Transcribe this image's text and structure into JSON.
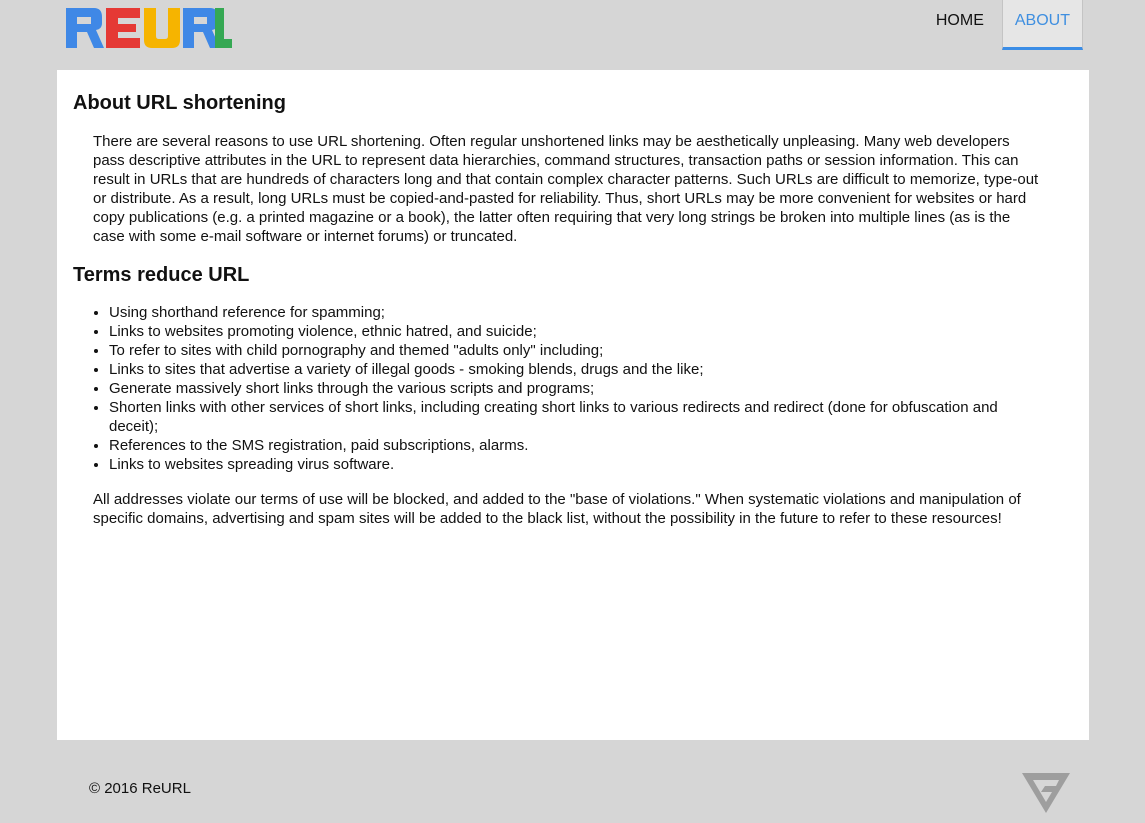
{
  "header": {
    "logo_text": "ReURL",
    "nav": [
      {
        "label": "HOME",
        "active": false
      },
      {
        "label": "ABOUT",
        "active": true
      }
    ]
  },
  "colors": {
    "page_bg": "#d6d6d6",
    "card_bg": "#ffffff",
    "accent": "#3b8de6",
    "logo_blue": "#3f88e6",
    "logo_red": "#e53935",
    "logo_yellow": "#f6b400",
    "logo_green": "#35a853",
    "footer_logo": "#9e9e9e"
  },
  "main": {
    "title": "About URL shortening",
    "intro": "There are several reasons to use URL shortening. Often regular unshortened links may be aesthetically unpleasing. Many web developers pass descriptive attributes in the URL to represent data hierarchies, command structures, transaction paths or session information. This can result in URLs that are hundreds of characters long and that contain complex character patterns. Such URLs are difficult to memorize, type-out or distribute. As a result, long URLs must be copied-and-pasted for reliability. Thus, short URLs may be more convenient for websites or hard copy publications (e.g. a printed magazine or a book), the latter often requiring that very long strings be broken into multiple lines (as is the case with some e-mail software or internet forums) or truncated.",
    "terms_title": "Terms reduce URL",
    "terms": [
      "Using shorthand reference for spamming;",
      "Links to websites promoting violence, ethnic hatred, and suicide;",
      "To refer to sites with child pornography and themed \"adults only\" including;",
      "Links to sites that advertise a variety of illegal goods - smoking blends, drugs and the like;",
      "Generate massively short links through the various scripts and programs;",
      "Shorten links with other services of short links, including creating short links to various redirects and redirect (done for obfuscation and deceit);",
      "References to the SMS registration, paid subscriptions, alarms.",
      "Links to websites spreading virus software."
    ],
    "closing": "All addresses violate our terms of use will be blocked, and added to the \"base of violations.\" When systematic violations and manipulation of specific domains, advertising and spam sites will be added to the black list, without the possibility in the future to refer to these resources!"
  },
  "footer": {
    "copyright": "© 2016 ReURL",
    "logo_icon": "triangle-v-logo-icon"
  }
}
